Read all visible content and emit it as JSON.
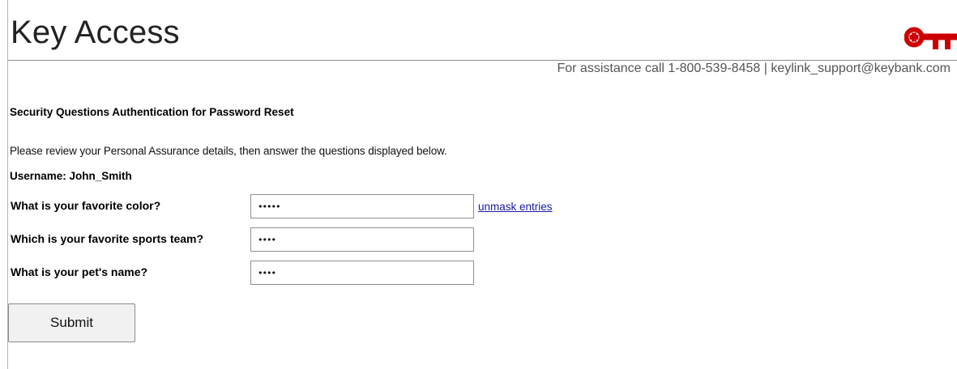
{
  "header": {
    "title": "Key Access",
    "logo_icon": "key-icon",
    "brand_color": "#cc0000"
  },
  "assistance_text": "For assistance call 1-800-539-8458 | keylink_support@keybank.com",
  "form": {
    "heading": "Security Questions Authentication for Password Reset",
    "intro": "Please review your Personal Assurance details, then answer the questions displayed below.",
    "username": "Username: John_Smith",
    "questions": [
      {
        "label": "What is your favorite color?",
        "value": "•••••"
      },
      {
        "label": "Which is your favorite sports team?",
        "value": "••••"
      },
      {
        "label": "What is your pet's name?",
        "value": "••••"
      }
    ],
    "unmask_label": "unmask entries",
    "submit_label": "Submit"
  }
}
